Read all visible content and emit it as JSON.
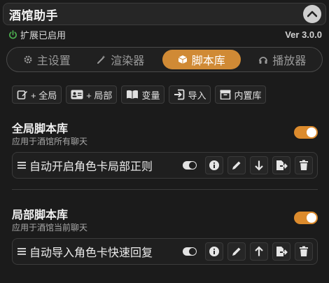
{
  "header": {
    "title": "酒馆助手"
  },
  "status": {
    "text": "扩展已启用",
    "version": "Ver 3.0.0"
  },
  "tabs": [
    {
      "label": "主设置",
      "icon": "gear-icon"
    },
    {
      "label": "渲染器",
      "icon": "magic-wand-icon"
    },
    {
      "label": "脚本库",
      "icon": "cube-icon"
    },
    {
      "label": "播放器",
      "icon": "headphones-icon"
    }
  ],
  "toolbar": {
    "global_add": "+ 全局",
    "local_add": "+ 局部",
    "variables": "变量",
    "import": "导入",
    "builtin": "内置库"
  },
  "global_section": {
    "title": "全局脚本库",
    "subtitle": "应用于酒馆所有聊天",
    "enabled": true,
    "scripts": [
      {
        "name": "自动开启角色卡局部正则",
        "enabled": true
      }
    ]
  },
  "local_section": {
    "title": "局部脚本库",
    "subtitle": "应用于酒馆当前聊天",
    "enabled": true,
    "scripts": [
      {
        "name": "自动导入角色卡快速回复",
        "enabled": true
      }
    ]
  },
  "colors": {
    "accent": "#d08a35",
    "status_green": "#4caf50"
  }
}
